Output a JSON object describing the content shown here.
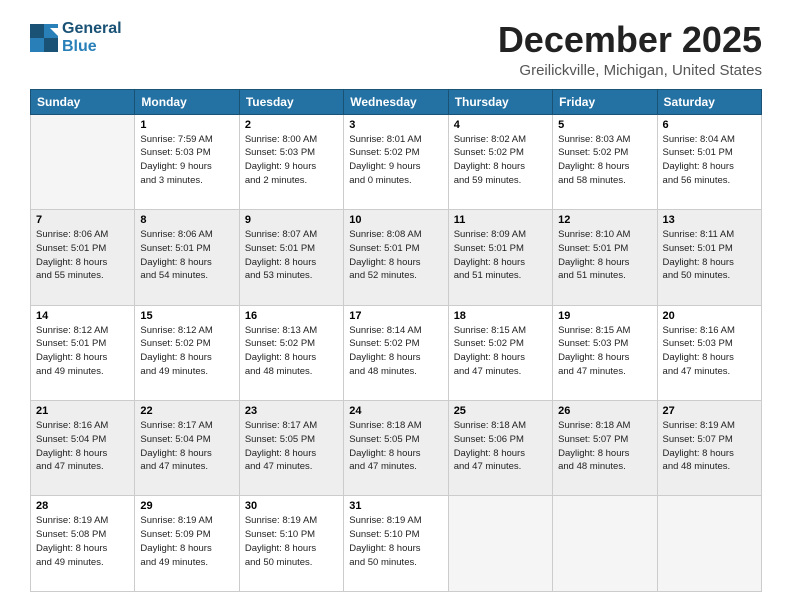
{
  "header": {
    "logo_line1": "General",
    "logo_line2": "Blue",
    "month": "December 2025",
    "location": "Greilickville, Michigan, United States"
  },
  "days_of_week": [
    "Sunday",
    "Monday",
    "Tuesday",
    "Wednesday",
    "Thursday",
    "Friday",
    "Saturday"
  ],
  "weeks": [
    [
      {
        "day": "",
        "info": ""
      },
      {
        "day": "1",
        "info": "Sunrise: 7:59 AM\nSunset: 5:03 PM\nDaylight: 9 hours\nand 3 minutes."
      },
      {
        "day": "2",
        "info": "Sunrise: 8:00 AM\nSunset: 5:03 PM\nDaylight: 9 hours\nand 2 minutes."
      },
      {
        "day": "3",
        "info": "Sunrise: 8:01 AM\nSunset: 5:02 PM\nDaylight: 9 hours\nand 0 minutes."
      },
      {
        "day": "4",
        "info": "Sunrise: 8:02 AM\nSunset: 5:02 PM\nDaylight: 8 hours\nand 59 minutes."
      },
      {
        "day": "5",
        "info": "Sunrise: 8:03 AM\nSunset: 5:02 PM\nDaylight: 8 hours\nand 58 minutes."
      },
      {
        "day": "6",
        "info": "Sunrise: 8:04 AM\nSunset: 5:01 PM\nDaylight: 8 hours\nand 56 minutes."
      }
    ],
    [
      {
        "day": "7",
        "info": "Sunrise: 8:06 AM\nSunset: 5:01 PM\nDaylight: 8 hours\nand 55 minutes."
      },
      {
        "day": "8",
        "info": "Sunrise: 8:06 AM\nSunset: 5:01 PM\nDaylight: 8 hours\nand 54 minutes."
      },
      {
        "day": "9",
        "info": "Sunrise: 8:07 AM\nSunset: 5:01 PM\nDaylight: 8 hours\nand 53 minutes."
      },
      {
        "day": "10",
        "info": "Sunrise: 8:08 AM\nSunset: 5:01 PM\nDaylight: 8 hours\nand 52 minutes."
      },
      {
        "day": "11",
        "info": "Sunrise: 8:09 AM\nSunset: 5:01 PM\nDaylight: 8 hours\nand 51 minutes."
      },
      {
        "day": "12",
        "info": "Sunrise: 8:10 AM\nSunset: 5:01 PM\nDaylight: 8 hours\nand 51 minutes."
      },
      {
        "day": "13",
        "info": "Sunrise: 8:11 AM\nSunset: 5:01 PM\nDaylight: 8 hours\nand 50 minutes."
      }
    ],
    [
      {
        "day": "14",
        "info": "Sunrise: 8:12 AM\nSunset: 5:01 PM\nDaylight: 8 hours\nand 49 minutes."
      },
      {
        "day": "15",
        "info": "Sunrise: 8:12 AM\nSunset: 5:02 PM\nDaylight: 8 hours\nand 49 minutes."
      },
      {
        "day": "16",
        "info": "Sunrise: 8:13 AM\nSunset: 5:02 PM\nDaylight: 8 hours\nand 48 minutes."
      },
      {
        "day": "17",
        "info": "Sunrise: 8:14 AM\nSunset: 5:02 PM\nDaylight: 8 hours\nand 48 minutes."
      },
      {
        "day": "18",
        "info": "Sunrise: 8:15 AM\nSunset: 5:02 PM\nDaylight: 8 hours\nand 47 minutes."
      },
      {
        "day": "19",
        "info": "Sunrise: 8:15 AM\nSunset: 5:03 PM\nDaylight: 8 hours\nand 47 minutes."
      },
      {
        "day": "20",
        "info": "Sunrise: 8:16 AM\nSunset: 5:03 PM\nDaylight: 8 hours\nand 47 minutes."
      }
    ],
    [
      {
        "day": "21",
        "info": "Sunrise: 8:16 AM\nSunset: 5:04 PM\nDaylight: 8 hours\nand 47 minutes."
      },
      {
        "day": "22",
        "info": "Sunrise: 8:17 AM\nSunset: 5:04 PM\nDaylight: 8 hours\nand 47 minutes."
      },
      {
        "day": "23",
        "info": "Sunrise: 8:17 AM\nSunset: 5:05 PM\nDaylight: 8 hours\nand 47 minutes."
      },
      {
        "day": "24",
        "info": "Sunrise: 8:18 AM\nSunset: 5:05 PM\nDaylight: 8 hours\nand 47 minutes."
      },
      {
        "day": "25",
        "info": "Sunrise: 8:18 AM\nSunset: 5:06 PM\nDaylight: 8 hours\nand 47 minutes."
      },
      {
        "day": "26",
        "info": "Sunrise: 8:18 AM\nSunset: 5:07 PM\nDaylight: 8 hours\nand 48 minutes."
      },
      {
        "day": "27",
        "info": "Sunrise: 8:19 AM\nSunset: 5:07 PM\nDaylight: 8 hours\nand 48 minutes."
      }
    ],
    [
      {
        "day": "28",
        "info": "Sunrise: 8:19 AM\nSunset: 5:08 PM\nDaylight: 8 hours\nand 49 minutes."
      },
      {
        "day": "29",
        "info": "Sunrise: 8:19 AM\nSunset: 5:09 PM\nDaylight: 8 hours\nand 49 minutes."
      },
      {
        "day": "30",
        "info": "Sunrise: 8:19 AM\nSunset: 5:10 PM\nDaylight: 8 hours\nand 50 minutes."
      },
      {
        "day": "31",
        "info": "Sunrise: 8:19 AM\nSunset: 5:10 PM\nDaylight: 8 hours\nand 50 minutes."
      },
      {
        "day": "",
        "info": ""
      },
      {
        "day": "",
        "info": ""
      },
      {
        "day": "",
        "info": ""
      }
    ]
  ]
}
